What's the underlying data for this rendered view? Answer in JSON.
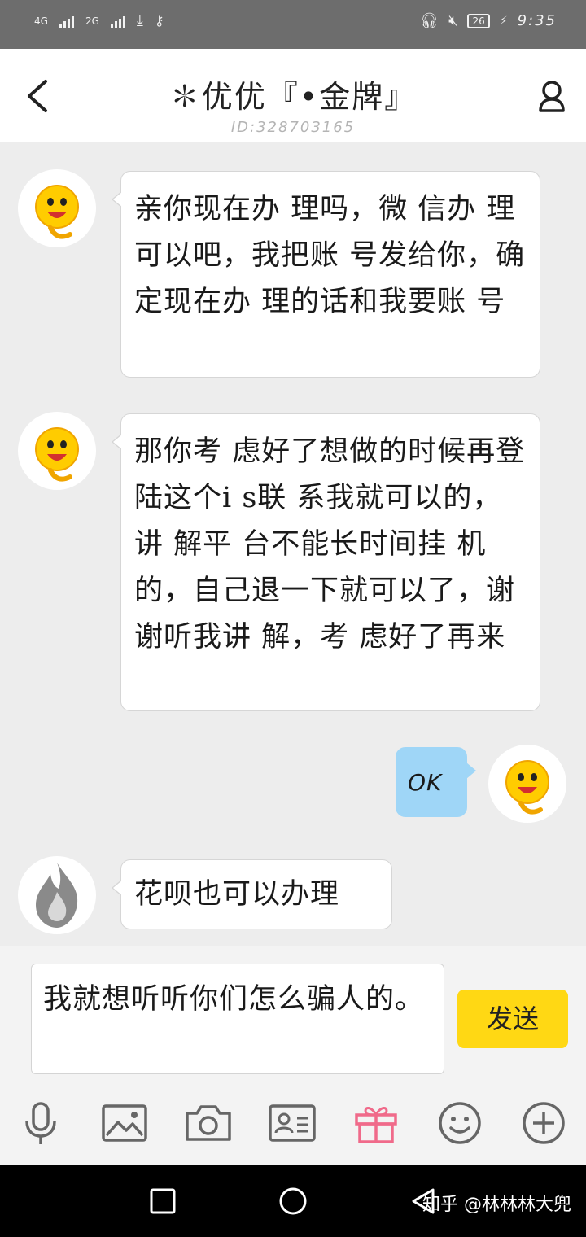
{
  "status_bar": {
    "net1": "4G",
    "net2": "2G",
    "battery": "26",
    "time": "9:35"
  },
  "header": {
    "title": "✽优优『•金牌』",
    "subtitle": "ID:328703165"
  },
  "messages": [
    {
      "side": "left",
      "avatar": "emoji-avatar",
      "text": "亲你现在办 理吗，微 信办 理可以吧，我把账 号发给你，确定现在办 理的话和我要账 号"
    },
    {
      "side": "left",
      "avatar": "emoji-avatar",
      "text": "那你考 虑好了想做的时候再登 陆这个i s联 系我就可以的，讲 解平 台不能长时间挂 机的，自己退一下就可以了，谢谢听我讲 解，考 虑好了再来"
    },
    {
      "side": "right",
      "avatar": "emoji-avatar",
      "text": "OK"
    },
    {
      "side": "left",
      "avatar": "flame-avatar",
      "text": "花呗也可以办理"
    }
  ],
  "input": {
    "value": "我就想听听你们怎么骗人的。",
    "send_label": "发送"
  },
  "toolbar": [
    "microphone-icon",
    "image-icon",
    "camera-icon",
    "contact-card-icon",
    "gift-icon",
    "emoji-icon",
    "plus-icon"
  ],
  "colors": {
    "accent_yellow": "#ffd814",
    "my_bubble": "#9fd6f7",
    "gift_pink": "#f06a8a"
  },
  "watermark": "知乎 @林林林大兜"
}
